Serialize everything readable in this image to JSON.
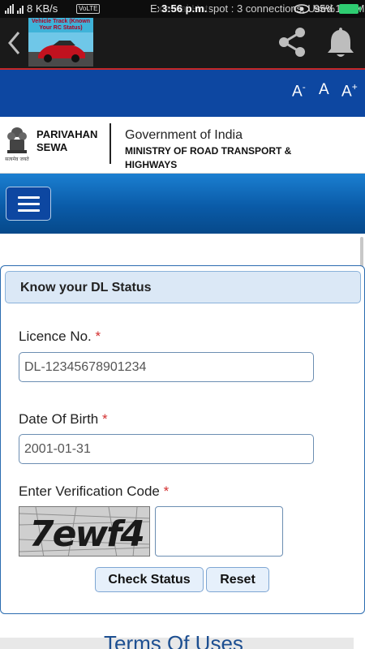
{
  "status_bar": {
    "carrier_info": "8 KB/s",
    "volte": "VoLTE",
    "notification": "External Hotspot : 3 connections, Used 105 MB",
    "time": "3:56 p.m.",
    "battery": "95%"
  },
  "app_bar": {
    "thumbnail_title": "Vehicle Track (Known Your  RC Status)"
  },
  "font_controls": {
    "decrease": "A",
    "decrease_sup": "-",
    "normal": "A",
    "increase": "A",
    "increase_sup": "+"
  },
  "header": {
    "brand_line1": "PARIVAHAN",
    "brand_line2": "SEWA",
    "emblem_caption": "सत्यमेव जयते",
    "gov": "Government of India",
    "ministry": "MINISTRY OF ROAD TRANSPORT & HIGHWAYS"
  },
  "form": {
    "title": "Know your DL Status",
    "licence_label": "Licence No.",
    "licence_value": "DL-12345678901234",
    "dob_label": "Date Of Birth",
    "dob_value": "2001-01-31",
    "captcha_label": "Enter Verification Code",
    "captcha_text": "7ewf4",
    "captcha_value": "",
    "required_mark": "*",
    "check_button": "Check Status",
    "reset_button": "Reset"
  },
  "footer": {
    "terms": "Terms Of Uses"
  },
  "colors": {
    "header_blue": "#0d47a1",
    "panel_head": "#dbe8f6",
    "required": "#d32f2f"
  }
}
